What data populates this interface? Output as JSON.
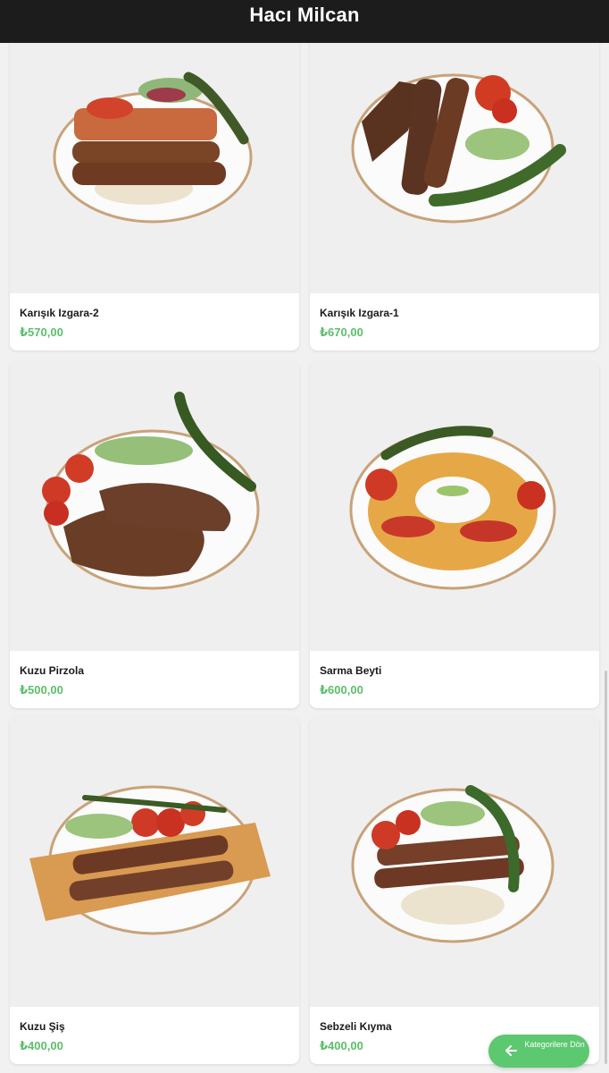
{
  "header": {
    "title": "Hacı Milcan"
  },
  "products": [
    {
      "name": "Karışık Izgara-2",
      "price": "₺570,00"
    },
    {
      "name": "Karışık Izgara-1",
      "price": "₺670,00"
    },
    {
      "name": "Kuzu Pirzola",
      "price": "₺500,00"
    },
    {
      "name": "Sarma Beyti",
      "price": "₺600,00"
    },
    {
      "name": "Kuzu Şiş",
      "price": "₺400,00"
    },
    {
      "name": "Sebzeli Kıyma",
      "price": "₺400,00"
    }
  ],
  "back_button": {
    "label": "Kategorilere Dön",
    "icon": "arrow-left-icon"
  },
  "colors": {
    "header_bg": "#1c1c1c",
    "price": "#5cbf6a",
    "button_bg": "#5cc870"
  }
}
